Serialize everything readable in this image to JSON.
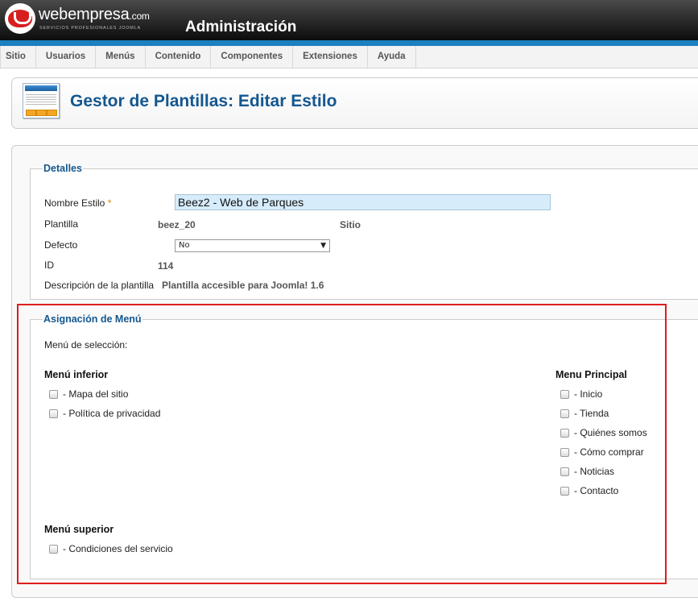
{
  "header": {
    "brand": "webempresa",
    "brand_domain": ".com",
    "tagline": "SERVICIOS PROFESIONALES JOOMLA",
    "title": "Administración"
  },
  "menu": [
    "Sitio",
    "Usuarios",
    "Menús",
    "Contenido",
    "Componentes",
    "Extensiones",
    "Ayuda"
  ],
  "toolbar": {
    "title": "Gestor de Plantillas: Editar Estilo"
  },
  "details": {
    "legend": "Detalles",
    "style_name_label": "Nombre Estilo",
    "required_mark": "*",
    "style_name_value": "Beez2 - Web de Parques",
    "template_label": "Plantilla",
    "template_value": "beez_20",
    "location_value": "Sitio",
    "default_label": "Defecto",
    "default_value": "No",
    "id_label": "ID",
    "id_value": "114",
    "description_label": "Descripción de la plantilla",
    "description_value": "Plantilla accesible para Joomla! 1.6"
  },
  "assignment": {
    "legend": "Asignación de Menú",
    "selection_label": "Menú de selección:",
    "groups": [
      {
        "title": "Menú inferior",
        "items": [
          "- Mapa del sitio",
          "- Política de privacidad"
        ]
      },
      {
        "title": "Menu Principal",
        "items": [
          "- Inicio",
          "- Tienda",
          "- Quiénes somos",
          "- Cómo comprar",
          "- Noticias",
          "- Contacto"
        ]
      },
      {
        "title": "Menú superior",
        "items": [
          "- Condiciones del servicio"
        ]
      }
    ]
  },
  "colors": {
    "header_blue_line": "#1c7fc0",
    "title_blue": "#14578f",
    "highlight_red": "#e01c1c",
    "logo_red": "#d61f1f"
  }
}
